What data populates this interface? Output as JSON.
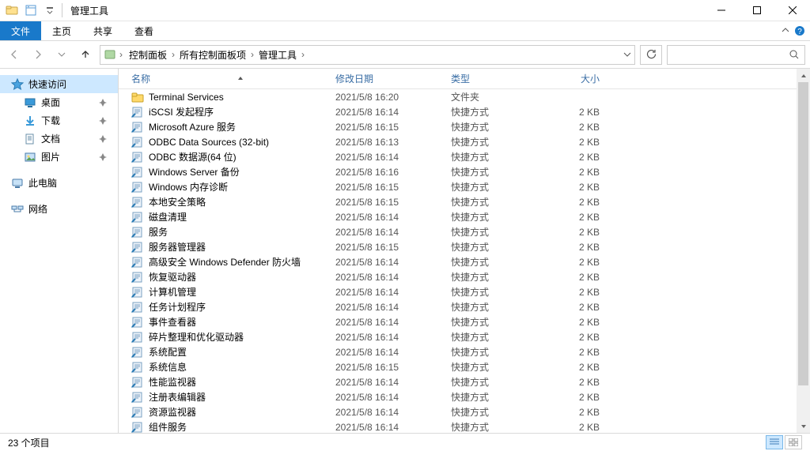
{
  "window": {
    "title": "管理工具"
  },
  "ribbon": {
    "file": "文件",
    "tabs": [
      "主页",
      "共享",
      "查看"
    ]
  },
  "breadcrumbs": [
    "控制面板",
    "所有控制面板项",
    "管理工具"
  ],
  "nav": {
    "quick_access": "快速访问",
    "quick_items": [
      {
        "label": "桌面",
        "icon": "desktop",
        "pinned": true
      },
      {
        "label": "下载",
        "icon": "downloads",
        "pinned": true
      },
      {
        "label": "文档",
        "icon": "documents",
        "pinned": true
      },
      {
        "label": "图片",
        "icon": "pictures",
        "pinned": true
      }
    ],
    "this_pc": "此电脑",
    "network": "网络"
  },
  "columns": {
    "name": "名称",
    "date": "修改日期",
    "type": "类型",
    "size": "大小"
  },
  "items": [
    {
      "name": "Terminal Services",
      "date": "2021/5/8 16:20",
      "type": "文件夹",
      "size": "",
      "icon": "folder"
    },
    {
      "name": "iSCSI 发起程序",
      "date": "2021/5/8 16:14",
      "type": "快捷方式",
      "size": "2 KB",
      "icon": "app"
    },
    {
      "name": "Microsoft Azure 服务",
      "date": "2021/5/8 16:15",
      "type": "快捷方式",
      "size": "2 KB",
      "icon": "app"
    },
    {
      "name": "ODBC Data Sources (32-bit)",
      "date": "2021/5/8 16:13",
      "type": "快捷方式",
      "size": "2 KB",
      "icon": "app"
    },
    {
      "name": "ODBC 数据源(64 位)",
      "date": "2021/5/8 16:14",
      "type": "快捷方式",
      "size": "2 KB",
      "icon": "app"
    },
    {
      "name": "Windows Server 备份",
      "date": "2021/5/8 16:16",
      "type": "快捷方式",
      "size": "2 KB",
      "icon": "app"
    },
    {
      "name": "Windows 内存诊断",
      "date": "2021/5/8 16:15",
      "type": "快捷方式",
      "size": "2 KB",
      "icon": "app"
    },
    {
      "name": "本地安全策略",
      "date": "2021/5/8 16:15",
      "type": "快捷方式",
      "size": "2 KB",
      "icon": "app"
    },
    {
      "name": "磁盘清理",
      "date": "2021/5/8 16:14",
      "type": "快捷方式",
      "size": "2 KB",
      "icon": "app"
    },
    {
      "name": "服务",
      "date": "2021/5/8 16:14",
      "type": "快捷方式",
      "size": "2 KB",
      "icon": "app"
    },
    {
      "name": "服务器管理器",
      "date": "2021/5/8 16:15",
      "type": "快捷方式",
      "size": "2 KB",
      "icon": "app"
    },
    {
      "name": "高级安全 Windows Defender 防火墙",
      "date": "2021/5/8 16:14",
      "type": "快捷方式",
      "size": "2 KB",
      "icon": "app"
    },
    {
      "name": "恢复驱动器",
      "date": "2021/5/8 16:14",
      "type": "快捷方式",
      "size": "2 KB",
      "icon": "app"
    },
    {
      "name": "计算机管理",
      "date": "2021/5/8 16:14",
      "type": "快捷方式",
      "size": "2 KB",
      "icon": "app"
    },
    {
      "name": "任务计划程序",
      "date": "2021/5/8 16:14",
      "type": "快捷方式",
      "size": "2 KB",
      "icon": "app"
    },
    {
      "name": "事件查看器",
      "date": "2021/5/8 16:14",
      "type": "快捷方式",
      "size": "2 KB",
      "icon": "app"
    },
    {
      "name": "碎片整理和优化驱动器",
      "date": "2021/5/8 16:14",
      "type": "快捷方式",
      "size": "2 KB",
      "icon": "app"
    },
    {
      "name": "系统配置",
      "date": "2021/5/8 16:14",
      "type": "快捷方式",
      "size": "2 KB",
      "icon": "app"
    },
    {
      "name": "系统信息",
      "date": "2021/5/8 16:15",
      "type": "快捷方式",
      "size": "2 KB",
      "icon": "app"
    },
    {
      "name": "性能监视器",
      "date": "2021/5/8 16:14",
      "type": "快捷方式",
      "size": "2 KB",
      "icon": "app"
    },
    {
      "name": "注册表编辑器",
      "date": "2021/5/8 16:14",
      "type": "快捷方式",
      "size": "2 KB",
      "icon": "app"
    },
    {
      "name": "资源监视器",
      "date": "2021/5/8 16:14",
      "type": "快捷方式",
      "size": "2 KB",
      "icon": "app"
    },
    {
      "name": "组件服务",
      "date": "2021/5/8 16:14",
      "type": "快捷方式",
      "size": "2 KB",
      "icon": "app"
    }
  ],
  "status": {
    "count_label": "23 个项目"
  }
}
